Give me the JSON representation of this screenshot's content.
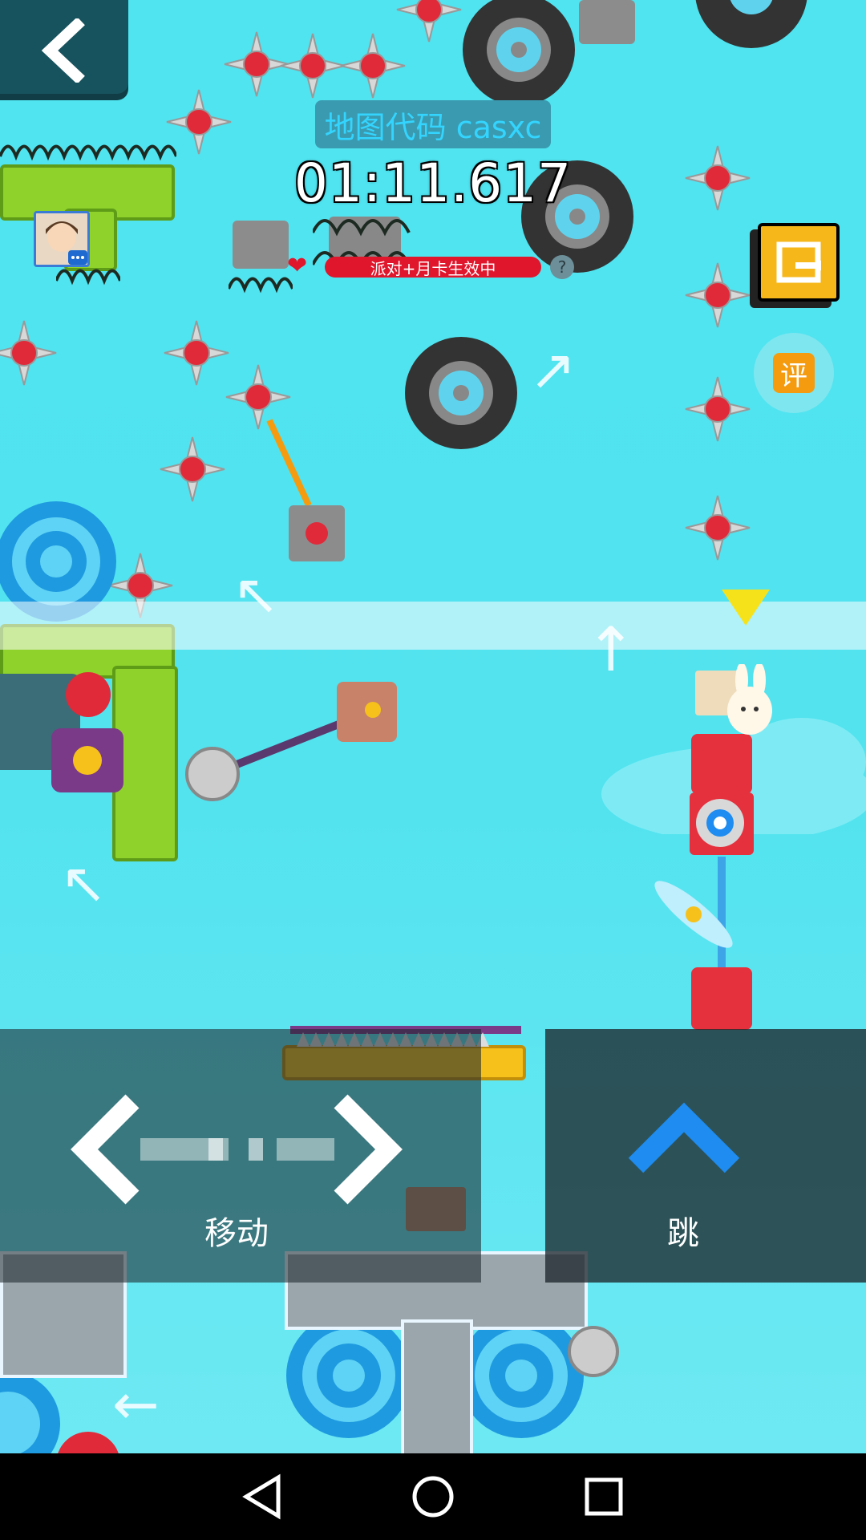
{
  "hud": {
    "back_icon": "chevron-left-icon",
    "map_code": "地图代码 casxc",
    "timer": "01:11.617",
    "party_status": "派对+月卡生效中",
    "heart_icon": "heart-icon",
    "help_icon": "?",
    "exit_icon": "exit-icon",
    "review_label": "评"
  },
  "controls": {
    "move_label": "移动",
    "jump_label": "跳"
  },
  "colors": {
    "sky": "#4fe4f0",
    "panel": "#17535e",
    "accent_yellow": "#f6b71b",
    "party_red": "#e0162c",
    "jump_blue": "#1e8cf0"
  },
  "nav": {
    "back_icon": "triangle-back-icon",
    "home_icon": "circle-home-icon",
    "recent_icon": "square-recents-icon"
  }
}
